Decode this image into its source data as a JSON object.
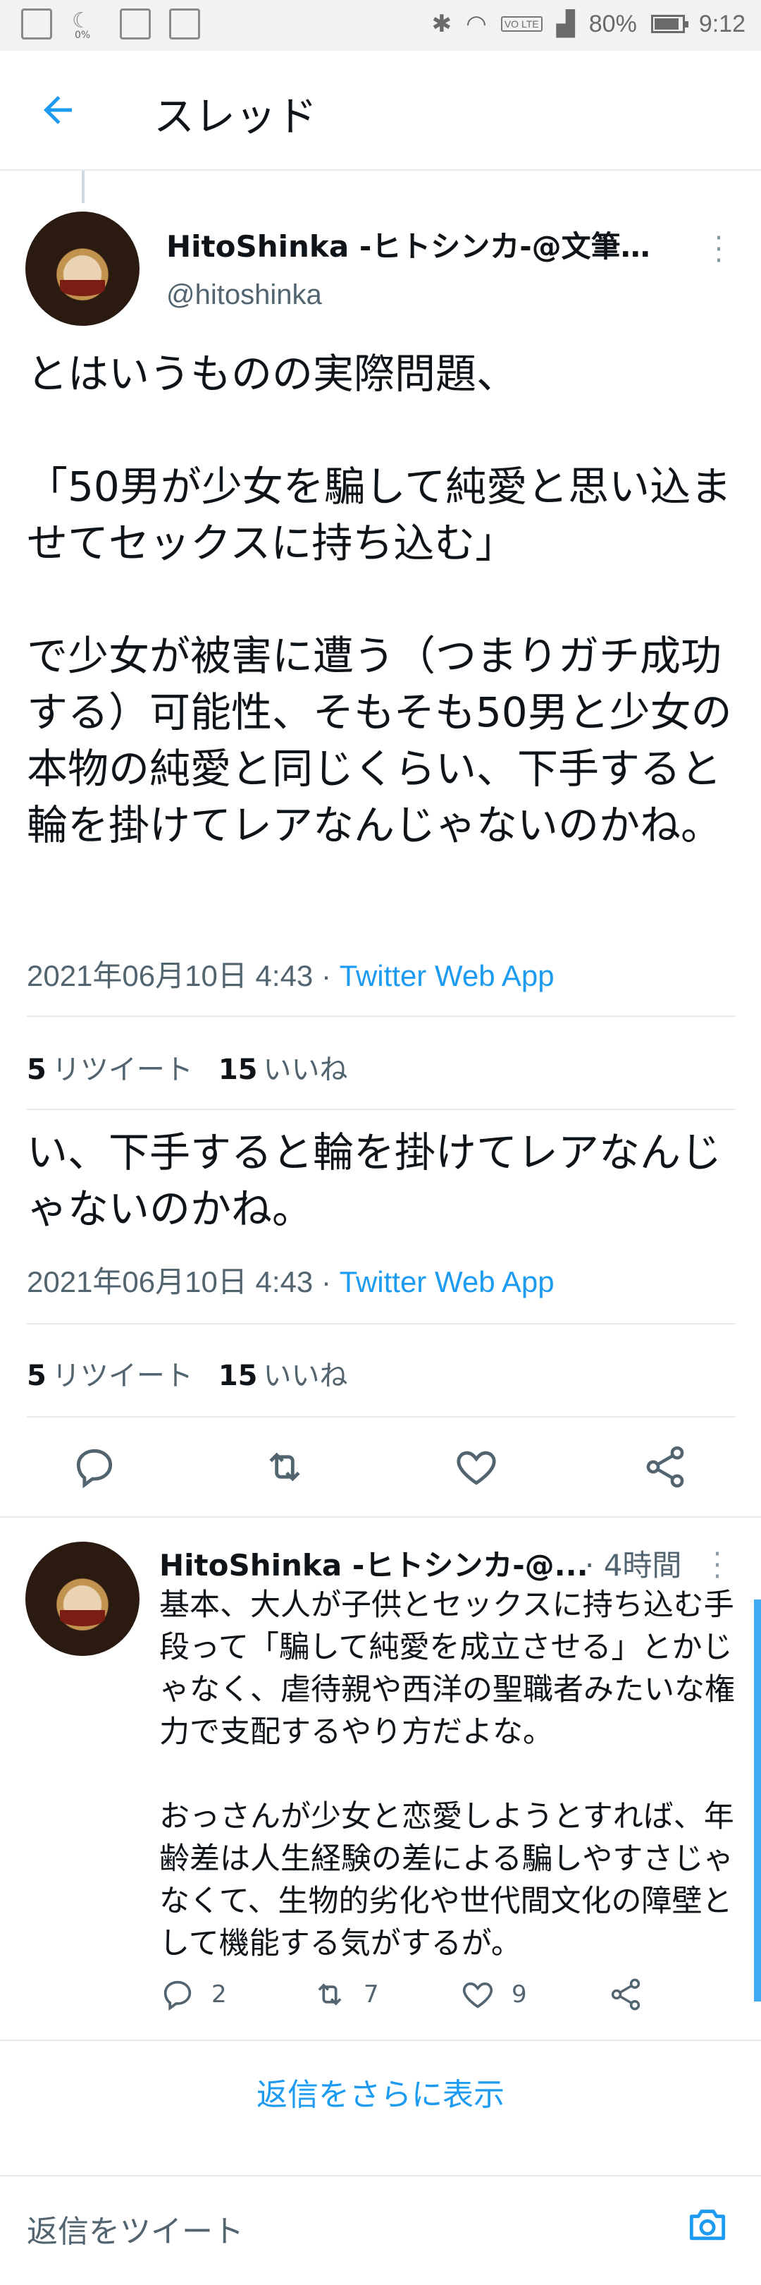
{
  "status_bar": {
    "battery": "80%",
    "time": "9:12",
    "moon_label": "0%",
    "lte": "VO LTE",
    "icons": [
      "calendar-icon",
      "moon-icon",
      "image-icon",
      "news-icon",
      "bluetooth-icon",
      "wifi-icon",
      "lte-icon",
      "signal-icon",
      "battery-icon"
    ]
  },
  "header": {
    "title": "スレッド"
  },
  "tweet": {
    "author_name": "HitoShinka -ヒトシンカ-@文筆業...",
    "handle": "@hitoshinka",
    "text": "とはいうものの実際問題、\n\n「50男が少女を騙して純愛と思い込ませてセックスに持ち込む」\n\nで少女が被害に遭う（つまりガチ成功する）可能性、そもそも50男と少女の本物の純愛と同じくらい、下手すると輪を掛けてレアなんじゃないのかね。",
    "date": "2021年06月10日 4:43 · ",
    "source": "Twitter Web App",
    "retweets": "5",
    "retweets_label": "リツイート",
    "likes": "15",
    "likes_label": "いいね",
    "repeat_text": "い、下手すると輪を掛けてレアなんじゃないのかね。"
  },
  "reply": {
    "author_name": "HitoShinka -ヒトシンカ-@...",
    "time": "· 4時間",
    "text": "基本、大人が子供とセックスに持ち込む手段って「騙して純愛を成立させる」とかじゃなく、虐待親や西洋の聖職者みたいな権力で支配するやり方だよな。\n\nおっさんが少女と恋愛しようとすれば、年齢差は人生経験の差による騙しやすさじゃなくて、生物的劣化や世代間文化の障壁として機能する気がするが。",
    "reply_count": "2",
    "retweet_count": "7",
    "like_count": "9"
  },
  "show_more": "返信をさらに表示",
  "composer_placeholder": "返信をツイート",
  "colors": {
    "accent": "#1d9bf0",
    "muted": "#536471",
    "divider": "#e6ecf0"
  }
}
